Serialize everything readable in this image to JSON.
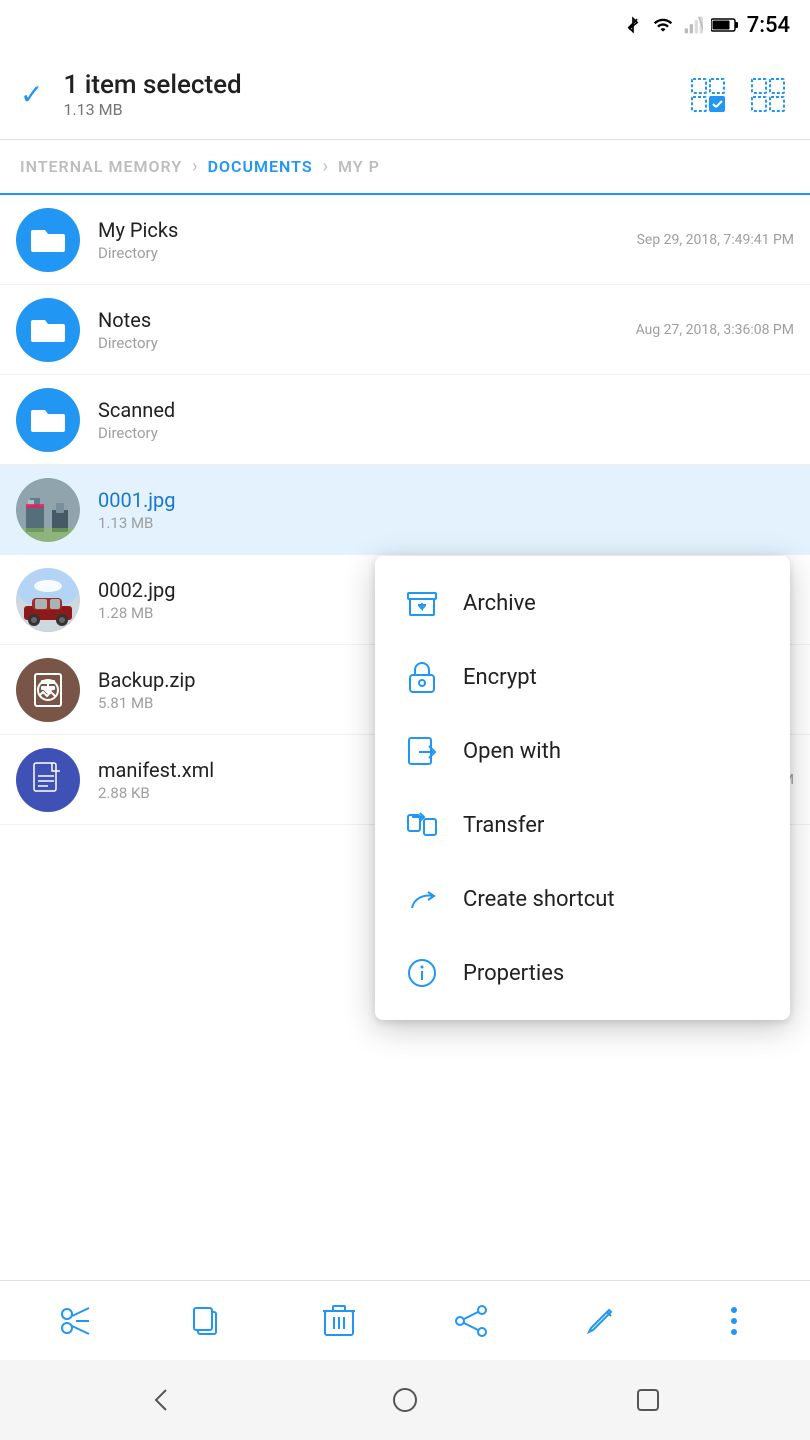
{
  "statusBar": {
    "time": "7:54",
    "icons": [
      "bluetooth",
      "wifi",
      "signal",
      "battery"
    ]
  },
  "header": {
    "selectedCount": "1 item selected",
    "selectedSize": "1.13 MB",
    "selectAllIcon": "select-all-icon",
    "selectInvertIcon": "select-invert-icon"
  },
  "breadcrumb": {
    "items": [
      {
        "label": "INTERNAL MEMORY",
        "active": false
      },
      {
        "label": "DOCUMENTS",
        "active": true
      },
      {
        "label": "MY P",
        "active": false
      }
    ]
  },
  "fileList": [
    {
      "name": "My Picks",
      "type": "Directory",
      "date": "Sep 29, 2018, 7:49:41 PM",
      "icon": "folder",
      "color": "blue",
      "selected": false
    },
    {
      "name": "Notes",
      "type": "Directory",
      "date": "Aug 27, 2018, 3:36:08 PM",
      "icon": "folder",
      "color": "blue",
      "selected": false
    },
    {
      "name": "Scanned",
      "type": "Directory",
      "date": "",
      "icon": "folder",
      "color": "blue",
      "selected": false
    },
    {
      "name": "0001.jpg",
      "type": "",
      "size": "1.13 MB",
      "date": "",
      "icon": "image-0001",
      "color": "teal",
      "selected": true
    },
    {
      "name": "0002.jpg",
      "type": "",
      "size": "1.28 MB",
      "date": "",
      "icon": "image-0002",
      "color": "gray",
      "selected": false
    },
    {
      "name": "Backup.zip",
      "type": "",
      "size": "5.81 MB",
      "date": "",
      "icon": "archive",
      "color": "brown",
      "selected": false
    },
    {
      "name": "manifest.xml",
      "type": "",
      "size": "2.88 KB",
      "date": "Jan 01, 2009, 9:00:00 AM",
      "icon": "document",
      "color": "dark-blue",
      "selected": false
    }
  ],
  "contextMenu": {
    "items": [
      {
        "label": "Archive",
        "icon": "archive-icon"
      },
      {
        "label": "Encrypt",
        "icon": "lock-icon"
      },
      {
        "label": "Open with",
        "icon": "open-with-icon"
      },
      {
        "label": "Transfer",
        "icon": "transfer-icon"
      },
      {
        "label": "Create shortcut",
        "icon": "shortcut-icon"
      },
      {
        "label": "Properties",
        "icon": "info-icon"
      }
    ]
  },
  "toolbar": {
    "cut": "✂",
    "copy": "⧉",
    "delete": "🗑",
    "share": "⇪",
    "edit": "✏",
    "more": "⋮"
  },
  "navBar": {
    "back": "◁",
    "home": "○",
    "recent": "□"
  }
}
